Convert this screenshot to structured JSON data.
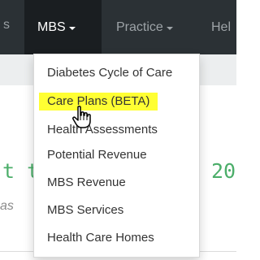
{
  "navbar": {
    "left_fragment": "s",
    "items": [
      {
        "label": "MBS",
        "active": true
      },
      {
        "label": "Practice",
        "active": false
      },
      {
        "label": "Hel",
        "active": false
      }
    ]
  },
  "background": {
    "line1_left": "t t",
    "line1_right": "20",
    "line2": "as"
  },
  "dropdown": {
    "items": [
      {
        "label": "Diabetes Cycle of Care"
      },
      {
        "label": "Care Plans (BETA)"
      },
      {
        "label": "Health Assessments"
      },
      {
        "label": "Potential Revenue"
      },
      {
        "label": "MBS Revenue"
      },
      {
        "label": "MBS Services"
      },
      {
        "label": "Health Care Homes"
      }
    ],
    "highlight_color": "#ffff33"
  },
  "colors": {
    "navbar_bg": "#2b3135",
    "active_nav_bg": "#1a1e21",
    "subbar_bg": "#eceeef",
    "accent_green": "#4cae6a"
  },
  "cursor": "hand-pointer-icon"
}
